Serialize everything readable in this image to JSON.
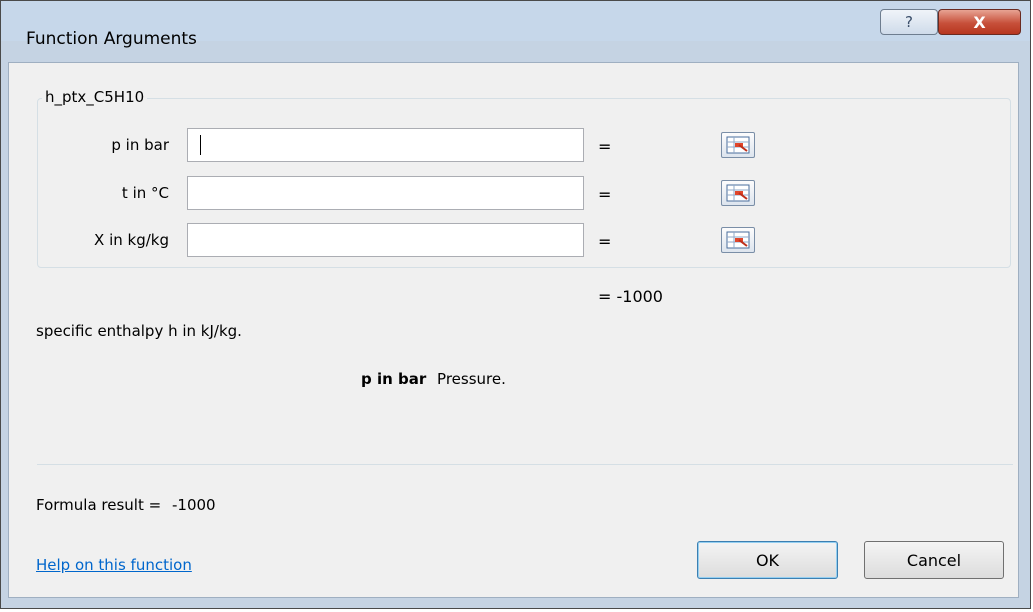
{
  "window": {
    "title": "Function Arguments",
    "help_glyph": "?",
    "close_glyph": "X"
  },
  "function": {
    "name": "h_ptx_C5H10",
    "arguments": [
      {
        "label": "p in bar",
        "value": "",
        "result": "="
      },
      {
        "label": "t in °C",
        "value": "",
        "result": "="
      },
      {
        "label": "X in kg/kg",
        "value": "",
        "result": "="
      }
    ],
    "result_line": "=  -1000",
    "description": "specific enthalpy h in kJ/kg.",
    "active_arg_name": "p in bar",
    "active_arg_desc": "Pressure."
  },
  "footer": {
    "formula_result_label": "Formula result =",
    "formula_result_value": "-1000",
    "help_link": "Help on this function",
    "ok_label": "OK",
    "cancel_label": "Cancel"
  },
  "colors": {
    "title_bar": "#c6d7ea",
    "dialog_bg": "#f0f0f0",
    "close_button": "#c7503a",
    "link": "#0066cc"
  }
}
